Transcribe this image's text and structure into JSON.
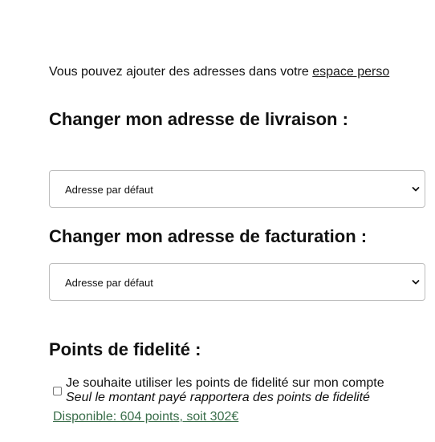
{
  "intro": {
    "text": "Vous pouvez ajouter des adresses dans votre ",
    "link_label": "espace perso"
  },
  "delivery": {
    "heading": "Changer mon adresse de livraison :",
    "selected": "Adresse par défaut"
  },
  "billing": {
    "heading": "Changer mon adresse de facturation :",
    "selected": "Adresse par défaut"
  },
  "loyalty": {
    "heading": "Points de fidelité :",
    "checkbox_label": "Je souhaite utiliser les points de fidelité sur mon compte",
    "note": "Seul le montant payé rapportera des points de fidelité",
    "available": "Disponible: 604 points, soit 302€",
    "checked": false
  },
  "colors": {
    "link": "#1a1a1a",
    "available": "#3a6e4a",
    "border": "#bdbdbd"
  },
  "icons": {
    "select_arrow": "chevron-down-icon"
  }
}
